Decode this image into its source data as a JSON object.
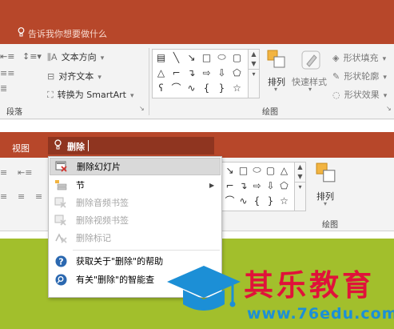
{
  "top_panel": {
    "tell_me": "告诉我你想要做什么",
    "text_direction": "文本方向",
    "align_text": "对齐文本",
    "convert_smartart": "转换为 SmartArt",
    "paragraph_group": "段落",
    "arrange": "排列",
    "quick_styles": "快速样式",
    "shape_fill": "形状填充",
    "shape_outline": "形状轮廓",
    "shape_effects": "形状效果",
    "drawing_group": "绘图"
  },
  "second_panel": {
    "view_tab": "视图",
    "search_query": "删除",
    "arrange": "排列",
    "drawing_group": "绘图"
  },
  "dropdown": {
    "items": [
      {
        "label": "删除幻灯片",
        "icon": "delete-slide-icon",
        "enabled": true,
        "highlighted": true
      },
      {
        "label": "节",
        "icon": "section-icon",
        "enabled": true,
        "has_submenu": true
      },
      {
        "label": "删除音频书签",
        "icon": "audio-bookmark-icon",
        "enabled": false
      },
      {
        "label": "删除视频书签",
        "icon": "video-bookmark-icon",
        "enabled": false
      },
      {
        "label": "删除标记",
        "icon": "markup-icon",
        "enabled": false
      },
      {
        "label": "获取关于\"删除\"的帮助",
        "icon": "help-icon",
        "enabled": true
      },
      {
        "label": "有关\"删除\"的智能查",
        "icon": "smart-lookup-icon",
        "enabled": true
      }
    ]
  },
  "watermark": {
    "name": "其乐教育",
    "url": "www.76edu.com"
  },
  "colors": {
    "title_bar": "#b7472a",
    "slide_green": "#a2bf2c",
    "watermark_red": "#e0123a",
    "watermark_blue": "#1c8fd6"
  }
}
